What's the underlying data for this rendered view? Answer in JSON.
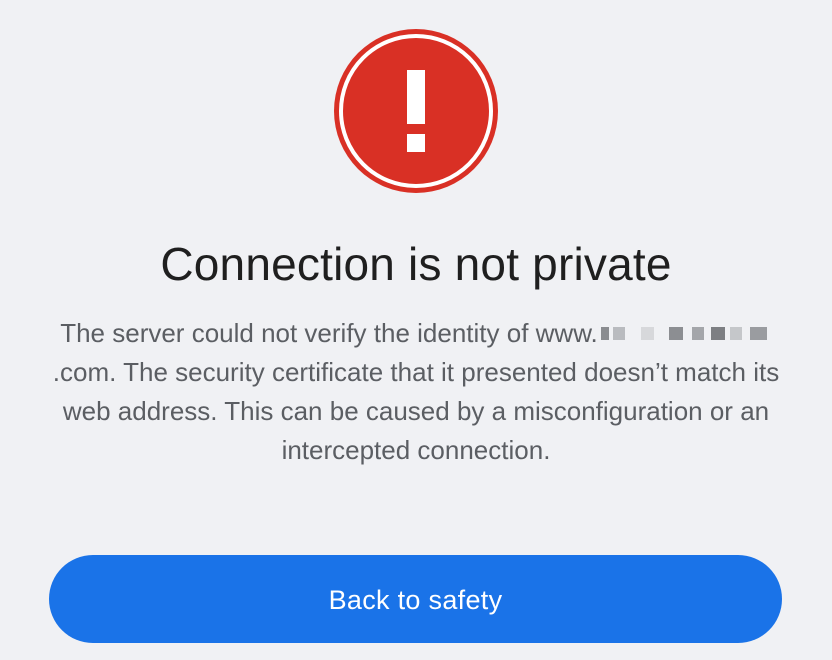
{
  "icon": {
    "name": "error-icon",
    "color": "#d93025",
    "symbol": "!"
  },
  "page": {
    "title": "Connection is not private",
    "body": {
      "line_start": "The server could not verify the identity of www.",
      "line_end": ".com. The security certificate that it presented doesn’t match its web address. This can be caused by a misconfiguration or an intercepted connection."
    },
    "button_label": "Back to safety",
    "button_color": "#1a73e8"
  }
}
